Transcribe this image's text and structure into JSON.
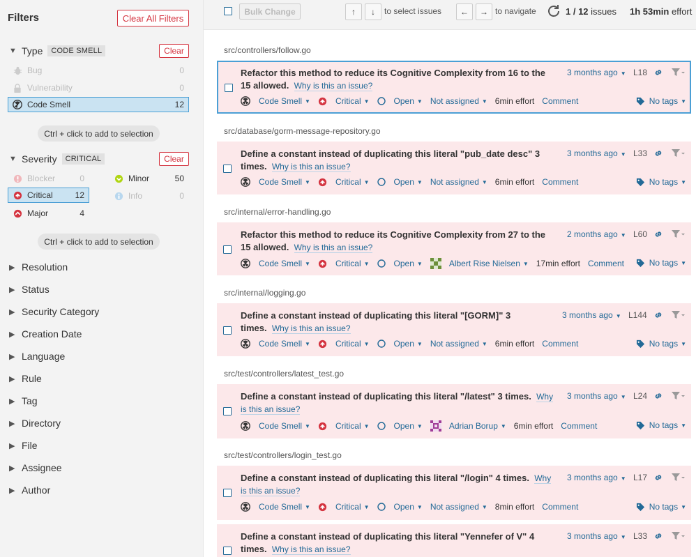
{
  "sidebar": {
    "title": "Filters",
    "clear_all": "Clear All Filters",
    "type": {
      "label": "Type",
      "badge": "CODE SMELL",
      "clear": "Clear",
      "items": [
        {
          "label": "Bug",
          "count": "0"
        },
        {
          "label": "Vulnerability",
          "count": "0"
        },
        {
          "label": "Code Smell",
          "count": "12"
        }
      ],
      "hint": "Ctrl + click to add to selection"
    },
    "severity": {
      "label": "Severity",
      "badge": "CRITICAL",
      "clear": "Clear",
      "items": [
        {
          "label": "Blocker",
          "count": "0"
        },
        {
          "label": "Minor",
          "count": "50"
        },
        {
          "label": "Critical",
          "count": "12"
        },
        {
          "label": "Info",
          "count": "0"
        },
        {
          "label": "Major",
          "count": "4"
        }
      ],
      "hint": "Ctrl + click to add to selection"
    },
    "facets": [
      "Resolution",
      "Status",
      "Security Category",
      "Creation Date",
      "Language",
      "Rule",
      "Tag",
      "Directory",
      "File",
      "Assignee",
      "Author"
    ]
  },
  "toolbar": {
    "bulk_change": "Bulk Change",
    "up_key": "↑",
    "down_key": "↓",
    "select_text": "to select issues",
    "left_key": "←",
    "right_key": "→",
    "navigate_text": "to navigate",
    "position": "1 / 12",
    "issues_word": "issues",
    "effort_value": "1h 53min",
    "effort_word": "effort"
  },
  "issues": [
    {
      "file": "src/controllers/follow.go",
      "msg": "Refactor this method to reduce its Cognitive Complexity from 16 to the 15 allowed.",
      "why": "Why is this an issue?",
      "date": "3 months ago",
      "line": "L18",
      "type": "Code Smell",
      "severity": "Critical",
      "status": "Open",
      "assignee": "Not assigned",
      "effort": "6min effort",
      "comment": "Comment",
      "tags": "No tags"
    },
    {
      "file": "src/database/gorm-message-repository.go",
      "msg": "Define a constant instead of duplicating this literal \"pub_date desc\" 3 times.",
      "why": "Why is this an issue?",
      "date": "3 months ago",
      "line": "L33",
      "type": "Code Smell",
      "severity": "Critical",
      "status": "Open",
      "assignee": "Not assigned",
      "effort": "6min effort",
      "comment": "Comment",
      "tags": "No tags"
    },
    {
      "file": "src/internal/error-handling.go",
      "msg": "Refactor this method to reduce its Cognitive Complexity from 27 to the 15 allowed.",
      "why": "Why is this an issue?",
      "date": "2 months ago",
      "line": "L60",
      "type": "Code Smell",
      "severity": "Critical",
      "status": "Open",
      "assignee": "Albert Rise Nielsen",
      "effort": "17min effort",
      "comment": "Comment",
      "tags": "No tags"
    },
    {
      "file": "src/internal/logging.go",
      "msg": "Define a constant instead of duplicating this literal \"[GORM]\" 3 times.",
      "why": "Why is this an issue?",
      "date": "3 months ago",
      "line": "L144",
      "type": "Code Smell",
      "severity": "Critical",
      "status": "Open",
      "assignee": "Not assigned",
      "effort": "6min effort",
      "comment": "Comment",
      "tags": "No tags"
    },
    {
      "file": "src/test/controllers/latest_test.go",
      "msg": "Define a constant instead of duplicating this literal \"/latest\" 3 times.",
      "why": "Why is this an issue?",
      "date": "3 months ago",
      "line": "L24",
      "type": "Code Smell",
      "severity": "Critical",
      "status": "Open",
      "assignee": "Adrian Borup",
      "effort": "6min effort",
      "comment": "Comment",
      "tags": "No tags"
    },
    {
      "file": "src/test/controllers/login_test.go",
      "msg": "Define a constant instead of duplicating this literal \"/login\" 4 times.",
      "why": "Why is this an issue?",
      "date": "3 months ago",
      "line": "L17",
      "type": "Code Smell",
      "severity": "Critical",
      "status": "Open",
      "assignee": "Not assigned",
      "effort": "8min effort",
      "comment": "Comment",
      "tags": "No tags"
    },
    {
      "msg": "Define a constant instead of duplicating this literal \"Yennefer of V\" 4 times.",
      "why": "Why is this an issue?",
      "date": "3 months ago",
      "line": "L33"
    }
  ],
  "colors": {
    "accent": "#236a97",
    "danger": "#d4333f",
    "issue_bg": "#fce8ea",
    "selected_bg": "#cae3f2",
    "minor_green": "#b0d513"
  }
}
